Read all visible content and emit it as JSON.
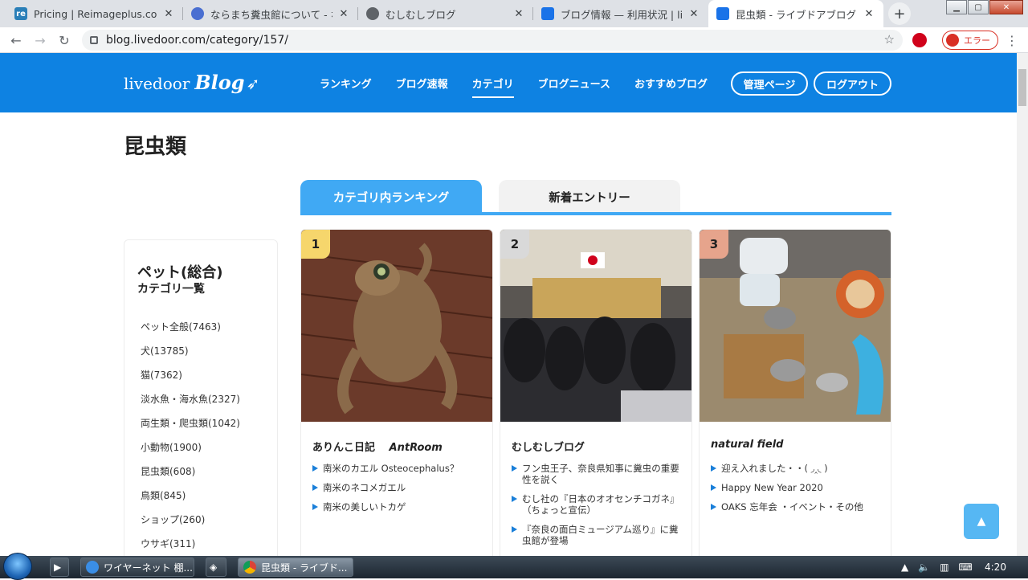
{
  "browser": {
    "tabs": [
      {
        "title": "Pricing | Reimageplus.com",
        "favicon_color": "#2a7fb8",
        "favicon_glyph": "re"
      },
      {
        "title": "ならまち糞虫館について - なら",
        "favicon_color": "#4a6fd1",
        "favicon_glyph": ""
      },
      {
        "title": "むしむしブログ",
        "favicon_color": "#5f6368",
        "favicon_glyph": ""
      },
      {
        "title": "ブログ情報 — 利用状況 | lived",
        "favicon_color": "#1a73e8",
        "favicon_glyph": ""
      },
      {
        "title": "昆虫類 - ライブドアブログ",
        "favicon_color": "#1a73e8",
        "favicon_glyph": ""
      }
    ],
    "url": "blog.livedoor.com/category/157/",
    "profile_chip": "エラー"
  },
  "site": {
    "logo_text": "livedoor",
    "logo_blog": "Blog",
    "nav": [
      "ランキング",
      "ブログ速報",
      "カテゴリ",
      "ブログニュース",
      "おすすめブログ"
    ],
    "admin_button": "管理ページ",
    "logout_button": "ログアウト",
    "header_color": "#0e82e2"
  },
  "page": {
    "title": "昆虫類",
    "tab_ranking": "カテゴリ内ランキング",
    "tab_new": "新着エントリー"
  },
  "sidebar": {
    "heading1": "ペット(総合)",
    "heading2": "カテゴリ一覧",
    "items": [
      "ペット全般(7463)",
      "犬(13785)",
      "猫(7362)",
      "淡水魚・海水魚(2327)",
      "両生類・爬虫類(1042)",
      "小動物(1900)",
      "昆虫類(608)",
      "鳥類(845)",
      "ショップ(260)",
      "ウサギ(311)"
    ]
  },
  "cards": [
    {
      "rank": "1",
      "rank_color": "#f6d66c",
      "blog_name": "ありんこ日記",
      "blog_name_en": "AntRoom",
      "entries": [
        "南米のカエル Osteocephalus？",
        "南米のネコメガエル",
        "南米の美しいトカゲ"
      ]
    },
    {
      "rank": "2",
      "rank_color": "#d9d9d9",
      "blog_name": "むしむしブログ",
      "blog_name_en": "",
      "entries": [
        "フン虫王子、奈良県知事に糞虫の重要性を説く",
        "むし社の『日本のオオセンチコガネ』（ちょっと宣伝）",
        "『奈良の面白ミュージアム巡り』に糞虫館が登場"
      ]
    },
    {
      "rank": "3",
      "rank_color": "#e6a48c",
      "blog_name": "",
      "blog_name_en": "natural field",
      "entries": [
        "迎え入れました・・( ◞‸◟ )",
        "Happy New Year 2020",
        "OAKS 忘年会 ・イベント・その他"
      ]
    }
  ],
  "taskbar": {
    "items": [
      "ワイヤーネット 棚...",
      "昆虫類 - ライブド..."
    ],
    "clock": "4:20"
  }
}
